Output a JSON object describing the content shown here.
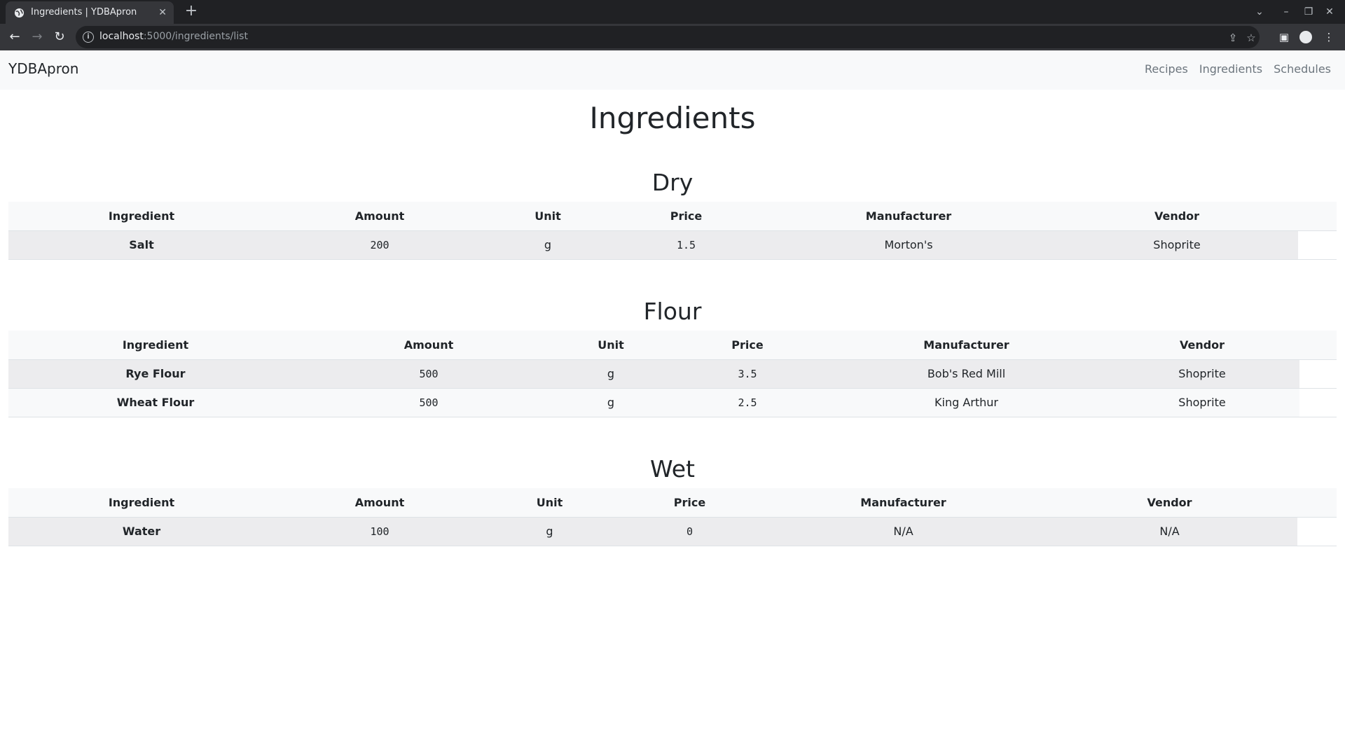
{
  "browser": {
    "tab_title": "Ingredients | YDBApron",
    "url_host": "localhost",
    "url_path": ":5000/ingredients/list"
  },
  "navbar": {
    "brand": "YDBApron",
    "links": [
      "Recipes",
      "Ingredients",
      "Schedules"
    ]
  },
  "page_title": "Ingredients",
  "columns": [
    "Ingredient",
    "Amount",
    "Unit",
    "Price",
    "Manufacturer",
    "Vendor"
  ],
  "sections": [
    {
      "title": "Dry",
      "rows": [
        [
          "Salt",
          "200",
          "g",
          "1.5",
          "Morton's",
          "Shoprite"
        ]
      ]
    },
    {
      "title": "Flour",
      "rows": [
        [
          "Rye Flour",
          "500",
          "g",
          "3.5",
          "Bob's Red Mill",
          "Shoprite"
        ],
        [
          "Wheat Flour",
          "500",
          "g",
          "2.5",
          "King Arthur",
          "Shoprite"
        ]
      ]
    },
    {
      "title": "Wet",
      "rows": [
        [
          "Water",
          "100",
          "g",
          "0",
          "N/A",
          "N/A"
        ]
      ]
    }
  ]
}
